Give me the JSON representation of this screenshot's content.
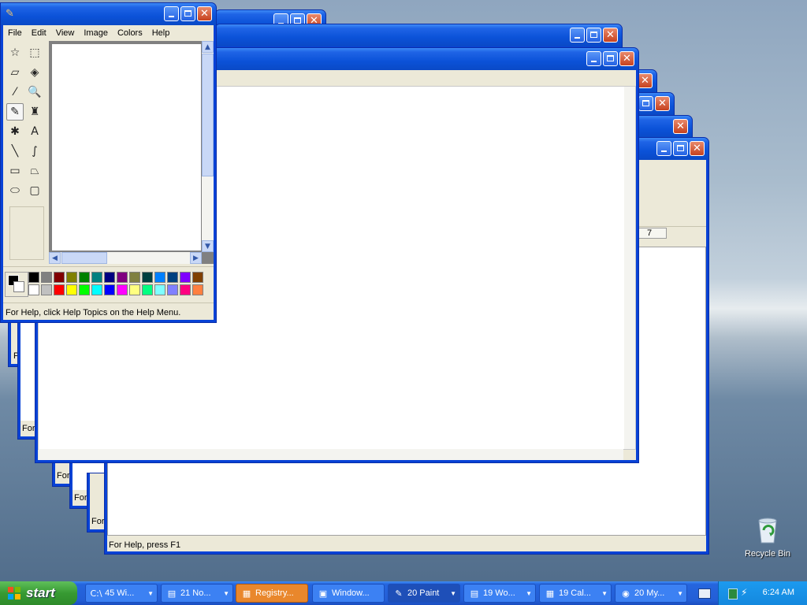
{
  "paint": {
    "menu": [
      "File",
      "Edit",
      "View",
      "Image",
      "Colors",
      "Help"
    ],
    "status": "For Help, click Help Topics on the Help Menu.",
    "tools": [
      {
        "name": "free-select-icon",
        "glyph": "☆"
      },
      {
        "name": "rect-select-icon",
        "glyph": "⬚"
      },
      {
        "name": "eraser-icon",
        "glyph": "▱"
      },
      {
        "name": "fill-bucket-icon",
        "glyph": "◈"
      },
      {
        "name": "color-picker-icon",
        "glyph": "⁄"
      },
      {
        "name": "magnifier-icon",
        "glyph": "🔍"
      },
      {
        "name": "pencil-icon",
        "glyph": "✎"
      },
      {
        "name": "brush-icon",
        "glyph": "♜"
      },
      {
        "name": "airbrush-icon",
        "glyph": "✱"
      },
      {
        "name": "text-icon",
        "glyph": "A"
      },
      {
        "name": "line-icon",
        "glyph": "╲"
      },
      {
        "name": "curve-icon",
        "glyph": "∫"
      },
      {
        "name": "rectangle-icon",
        "glyph": "▭"
      },
      {
        "name": "polygon-icon",
        "glyph": "⏢"
      },
      {
        "name": "ellipse-icon",
        "glyph": "⬭"
      },
      {
        "name": "rounded-rect-icon",
        "glyph": "▢"
      }
    ],
    "palette_top": [
      "#000000",
      "#808080",
      "#800000",
      "#808000",
      "#008000",
      "#008080",
      "#000080",
      "#800080",
      "#808040",
      "#004040",
      "#0080ff",
      "#004080",
      "#8000ff",
      "#804000"
    ],
    "palette_bottom": [
      "#ffffff",
      "#c0c0c0",
      "#ff0000",
      "#ffff00",
      "#00ff00",
      "#00ffff",
      "#0000ff",
      "#ff00ff",
      "#ffff80",
      "#00ff80",
      "#80ffff",
      "#8080ff",
      "#ff0080",
      "#ff8040"
    ]
  },
  "back_windows": {
    "status_for_help": "For Help, press F1",
    "status_for": "For",
    "status_for_help_short": "For Help",
    "status_p": "P",
    "toolbar_seven": "7"
  },
  "taskbar": {
    "start": "start",
    "tasks": [
      {
        "label": "45 Wi...",
        "icon": "C:\\"
      },
      {
        "label": "21 No...",
        "icon": "▤"
      },
      {
        "label": "Registry...",
        "icon": "▦"
      },
      {
        "label": "Window...",
        "icon": "▣"
      },
      {
        "label": "20 Paint",
        "icon": "✎"
      },
      {
        "label": "19 Wo...",
        "icon": "▤"
      },
      {
        "label": "19 Cal...",
        "icon": "▦"
      },
      {
        "label": "20 My...",
        "icon": "◉"
      }
    ],
    "clock": "6:24 AM"
  },
  "desktop": {
    "recycle_bin": "Recycle Bin"
  }
}
